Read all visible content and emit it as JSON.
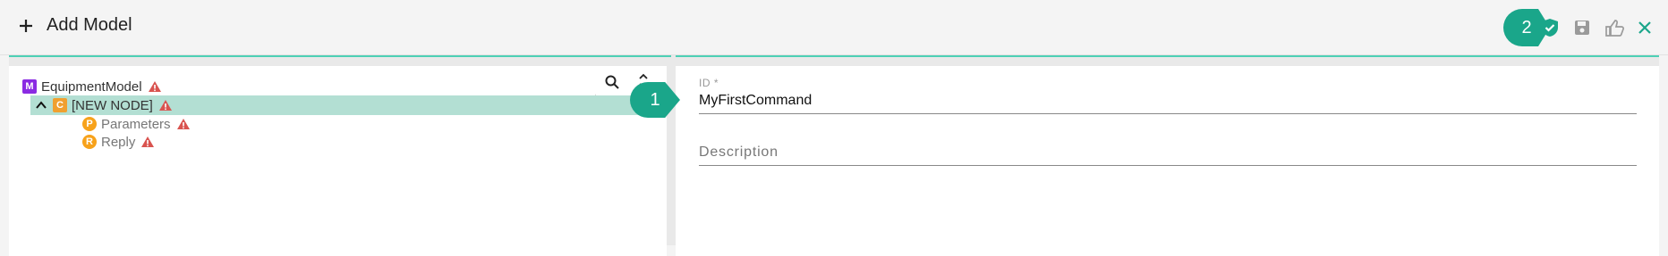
{
  "header": {
    "title": "Add Model",
    "add_icon": "plus-icon",
    "callout_label": "2",
    "actions": [
      "validate-icon",
      "save-icon",
      "approve-icon",
      "close-icon"
    ]
  },
  "tree": {
    "root": {
      "badge": "M",
      "label": "EquipmentModel"
    },
    "selected": {
      "badge": "C",
      "label": "[NEW NODE]"
    },
    "children": [
      {
        "badge": "P",
        "label": "Parameters"
      },
      {
        "badge": "R",
        "label": "Reply"
      }
    ]
  },
  "form": {
    "callout_label": "1",
    "id_label": "ID *",
    "id_value": "MyFirstCommand",
    "description_label": "Description"
  },
  "colors": {
    "accent": "#1aa68a",
    "selected_row": "#b3dfd3",
    "warning": "#d9534f",
    "model_badge": "#8a2be2",
    "child_badge": "#f7a21b"
  }
}
